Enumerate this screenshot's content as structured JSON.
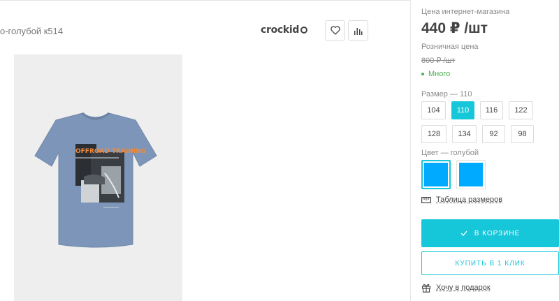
{
  "product": {
    "title": "о-голубой к514",
    "brand": "crockid",
    "icons": {
      "favorite": "heart-icon",
      "compare": "bar-chart-icon"
    },
    "shirt_print_text": "OFFROAD TRAINING"
  },
  "pricing": {
    "online_label": "Цена интернет-магазина",
    "online_price": "440 ₽ /шт",
    "retail_label": "Розничная цена",
    "retail_price": "800 ₽ /шт",
    "stock": "Много"
  },
  "size": {
    "label": "Размер",
    "selected": "110",
    "options": [
      "104",
      "110",
      "116",
      "122",
      "128",
      "134",
      "92",
      "98"
    ]
  },
  "color": {
    "label": "Цвет",
    "selected": "голубой",
    "swatch_color": "#00aaff"
  },
  "links": {
    "size_table": "Таблица размеров",
    "gift": "Хочу в подарок"
  },
  "buttons": {
    "in_cart": "В КОРЗИНЕ",
    "one_click": "КУПИТЬ В 1 КЛИК"
  },
  "colors": {
    "accent": "#16c6d9",
    "stock_green": "#4caf50",
    "shirt": "#7c95b8"
  }
}
